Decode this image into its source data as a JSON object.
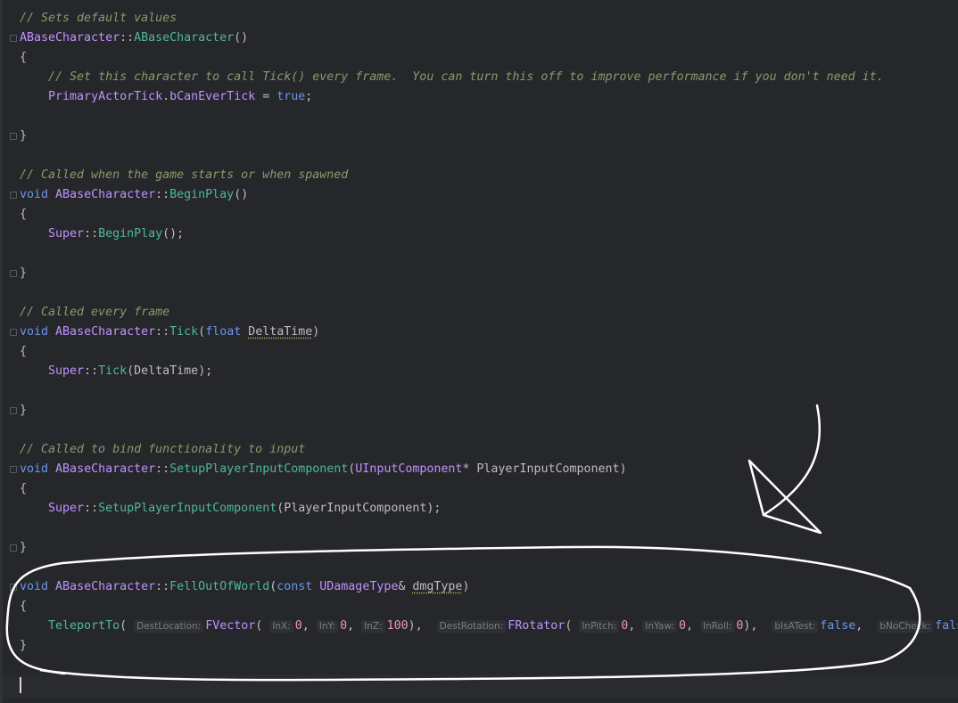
{
  "code": {
    "comment_defaults": "// Sets default values",
    "ctor_class": "ABaseCharacter",
    "ctor_sep": "::",
    "ctor_name": "ABaseCharacter",
    "ctor_parens": "()",
    "brace_open": "{",
    "brace_close": "}",
    "ctor_comment": "// Set this character to call Tick() every frame.  You can turn this off to improve performance if you don't need it.",
    "tick_field_a": "PrimaryActorTick",
    "tick_field_dot": ".",
    "tick_field_b": "bCanEverTick",
    "assign": " = ",
    "true_kw": "true",
    "semi": ";",
    "comment_begin": "// Called when the game starts or when spawned",
    "void_kw": "void",
    "begin_fn": "BeginPlay",
    "super_kw": "Super",
    "call_end": "();",
    "comment_tick": "// Called every frame",
    "tick_fn": "Tick",
    "float_kw": "float",
    "delta_time": "DeltaTime",
    "comment_bind": "// Called to bind functionality to input",
    "setup_fn": "SetupPlayerInputComponent",
    "uinput_cls": "UInputComponent",
    "player_input": "PlayerInputComponent",
    "fell_fn": "FellOutOfWorld",
    "const_kw": "const",
    "udamage_cls": "UDamageType",
    "dmg_param": "dmgType",
    "teleport_fn": "TeleportTo",
    "hint_dest_loc": "DestLocation:",
    "fvector": "FVector",
    "hint_inx": "InX:",
    "hint_iny": "InY:",
    "hint_inz": "InZ:",
    "zero": "0",
    "hundred": "100",
    "hint_dest_rot": "DestRotation:",
    "frotator": "FRotator",
    "hint_pitch": "InPitch:",
    "hint_yaw": "InYaw:",
    "hint_roll": "InRoll:",
    "hint_test": "bIsATest:",
    "hint_nocheck": "bNoCheck:",
    "false_kw": "false"
  },
  "colors": {
    "background": "#25272b",
    "comment": "#8b9a6b",
    "class": "#c191ff",
    "function": "#4eb89a",
    "keyword": "#6c95eb",
    "number": "#ed94c0",
    "annotation": "#ffffff"
  }
}
